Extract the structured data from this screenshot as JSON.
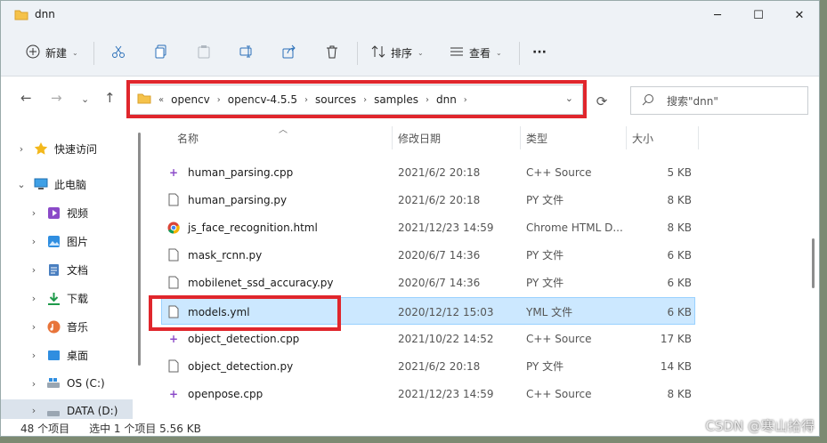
{
  "window": {
    "title": "dnn",
    "minimize": "─",
    "maximize": "☐",
    "close": "✕"
  },
  "toolbar": {
    "new_label": "新建",
    "sort_label": "排序",
    "view_label": "查看",
    "more_label": "···"
  },
  "address": {
    "overflow": "«",
    "crumbs": [
      "opencv",
      "opencv-4.5.5",
      "sources",
      "samples",
      "dnn"
    ]
  },
  "search": {
    "placeholder": "搜索\"dnn\""
  },
  "sidebar": {
    "items": [
      {
        "label": "快速访问",
        "icon": "star-icon"
      },
      {
        "label": "此电脑",
        "icon": "computer-icon"
      },
      {
        "label": "视频",
        "icon": "video-icon"
      },
      {
        "label": "图片",
        "icon": "pictures-icon"
      },
      {
        "label": "文档",
        "icon": "documents-icon"
      },
      {
        "label": "下载",
        "icon": "download-icon"
      },
      {
        "label": "音乐",
        "icon": "music-icon"
      },
      {
        "label": "桌面",
        "icon": "desktop-icon"
      },
      {
        "label": "OS (C:)",
        "icon": "drive-icon"
      },
      {
        "label": "DATA (D:)",
        "icon": "drive-icon"
      }
    ]
  },
  "columns": {
    "name": "名称",
    "date": "修改日期",
    "type": "类型",
    "size": "大小"
  },
  "files": [
    {
      "name": "human_parsing.cpp",
      "date": "2021/6/2 20:18",
      "type": "C++ Source",
      "size": "5 KB",
      "icon": "cpp-file-icon"
    },
    {
      "name": "human_parsing.py",
      "date": "2021/6/2 20:18",
      "type": "PY 文件",
      "size": "8 KB",
      "icon": "file-icon"
    },
    {
      "name": "js_face_recognition.html",
      "date": "2021/12/23 14:59",
      "type": "Chrome HTML D...",
      "size": "8 KB",
      "icon": "chrome-icon"
    },
    {
      "name": "mask_rcnn.py",
      "date": "2020/6/7 14:36",
      "type": "PY 文件",
      "size": "6 KB",
      "icon": "file-icon"
    },
    {
      "name": "mobilenet_ssd_accuracy.py",
      "date": "2020/6/7 14:36",
      "type": "PY 文件",
      "size": "6 KB",
      "icon": "file-icon"
    },
    {
      "name": "models.yml",
      "date": "2020/12/12 15:03",
      "type": "YML 文件",
      "size": "6 KB",
      "icon": "file-icon"
    },
    {
      "name": "object_detection.cpp",
      "date": "2021/10/22 14:52",
      "type": "C++ Source",
      "size": "17 KB",
      "icon": "cpp-file-icon"
    },
    {
      "name": "object_detection.py",
      "date": "2021/6/2 20:18",
      "type": "PY 文件",
      "size": "14 KB",
      "icon": "file-icon"
    },
    {
      "name": "openpose.cpp",
      "date": "2021/12/23 14:59",
      "type": "C++ Source",
      "size": "8 KB",
      "icon": "cpp-file-icon"
    }
  ],
  "status": {
    "count": "48 个项目",
    "selection": "选中 1 个项目  5.56 KB"
  },
  "watermark": "CSDN @寒山拾得",
  "colors": {
    "highlight_box": "#e0262c",
    "selection": "#cce8ff"
  }
}
